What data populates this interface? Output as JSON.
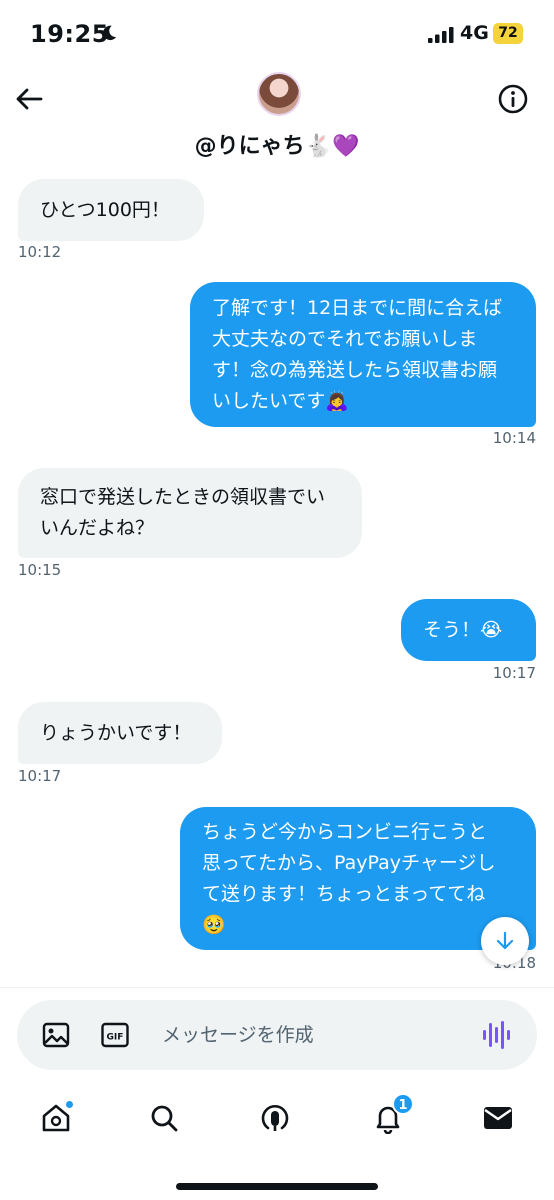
{
  "status_bar": {
    "time": "19:25",
    "network": "4G",
    "battery": "72",
    "focus_icon": "moon-icon",
    "battery_color": "#f5d33a"
  },
  "header": {
    "contact_name": "@りにゃち🐇💜",
    "back_icon": "back-arrow-icon",
    "info_icon": "info-icon"
  },
  "messages": [
    {
      "direction": "in",
      "text": "ひとつ100円！",
      "time": "10:12"
    },
    {
      "direction": "out",
      "text": "了解です！12日までに間に合えば\n大丈夫なのでそれでお願いしま\nす！念の為発送したら領収書お願\nいしたいです🙇‍♀️",
      "time": "10:14"
    },
    {
      "direction": "in",
      "text": "窓口で発送したときの領収書でい\nいんだよね？",
      "time": "10:15"
    },
    {
      "direction": "out",
      "text": "そう！😭",
      "time": "10:17"
    },
    {
      "direction": "in",
      "text": "りょうかいです！",
      "time": "10:17"
    },
    {
      "direction": "out",
      "text": "ちょうど今からコンビニ行こうと\n思ってたから、PayPayチャージし\nて送ります！ちょっとまっててね\n🥹",
      "time": "10:18"
    }
  ],
  "composer": {
    "placeholder": "メッセージを作成",
    "icons": [
      "image-icon",
      "gif-icon",
      "voice-icon"
    ]
  },
  "tabbar": {
    "notifications_count": "1",
    "icons": [
      "home-icon",
      "search-icon",
      "spaces-icon",
      "bell-icon",
      "mail-icon"
    ]
  },
  "colors": {
    "accent": "#1d9bf0",
    "incoming_bubble": "#eff3f4",
    "voice_accent": "#7856ff"
  }
}
